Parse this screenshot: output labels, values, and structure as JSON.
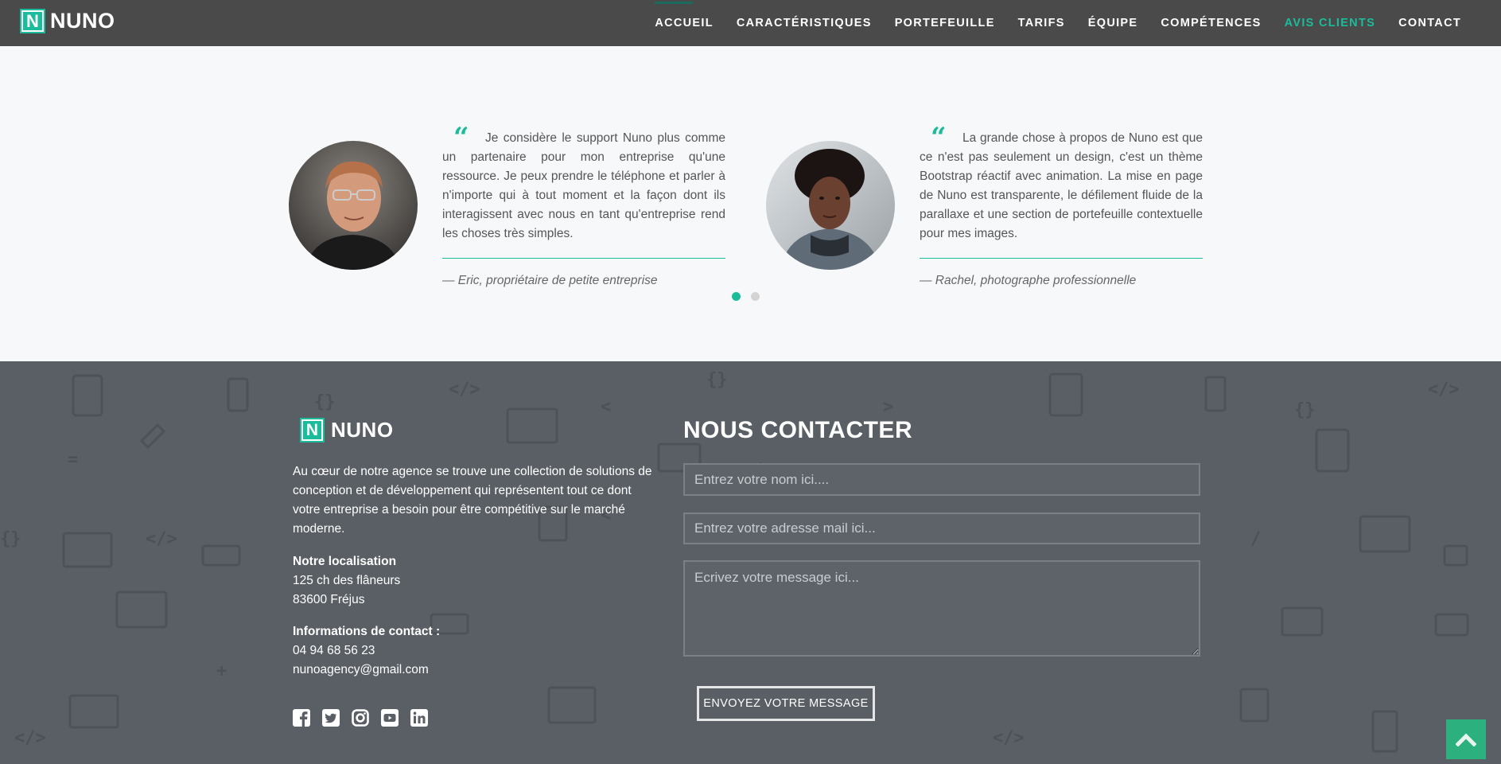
{
  "brand": {
    "name": "NUNO",
    "mark": "N",
    "accent": "#1bbc9b"
  },
  "nav": {
    "items": [
      {
        "label": "ACCUEIL"
      },
      {
        "label": "CARACTÉRISTIQUES"
      },
      {
        "label": "PORTEFEUILLE"
      },
      {
        "label": "TARIFS"
      },
      {
        "label": "ÉQUIPE"
      },
      {
        "label": "COMPÉTENCES"
      },
      {
        "label": "AVIS CLIENTS"
      },
      {
        "label": "CONTACT"
      }
    ],
    "active": "AVIS CLIENTS"
  },
  "testimonials": [
    {
      "quote_mark": "“",
      "text": "Je considère le support Nuno plus comme un partenaire pour mon entreprise qu'une ressource. Je peux prendre le téléphone et parler à n'importe qui à tout moment et la façon dont ils interagissent avec nous en tant qu'entreprise rend les choses très simples.",
      "author": "— Eric, propriétaire de petite entreprise"
    },
    {
      "quote_mark": "“",
      "text": "La grande chose à propos de Nuno est que ce n'est pas seulement un design, c'est un thème Bootstrap réactif avec animation. La mise en page de Nuno est transparente, le défilement fluide de la parallaxe et une section de portefeuille contextuelle pour mes images.",
      "author": "— Rachel, photographe professionnelle"
    }
  ],
  "carousel": {
    "pages": 2,
    "current": 1
  },
  "footer": {
    "about": "Au cœur de notre agence se trouve une collection de solutions de conception et de développement qui représentent tout ce dont votre entreprise a besoin pour être compétitive sur le marché moderne.",
    "location": {
      "title": "Notre localisation",
      "line1": "125 ch des flâneurs",
      "line2": "83600 Fréjus"
    },
    "contact_info": {
      "title": "Informations de contact :",
      "phone": "04 94 68 56 23",
      "email": "nunoagency@gmail.com"
    },
    "socials": [
      "facebook-icon",
      "twitter-icon",
      "instagram-icon",
      "youtube-icon",
      "linkedin-icon"
    ]
  },
  "contact_form": {
    "title": "NOUS CONTACTER",
    "name_placeholder": "Entrez votre nom ici....",
    "email_placeholder": "Entrez votre adresse mail ici...",
    "message_placeholder": "Ecrivez votre message ici...",
    "submit_label": "ENVOYEZ VOTRE MESSAGE"
  },
  "back_to_top": "chevron-up-icon"
}
